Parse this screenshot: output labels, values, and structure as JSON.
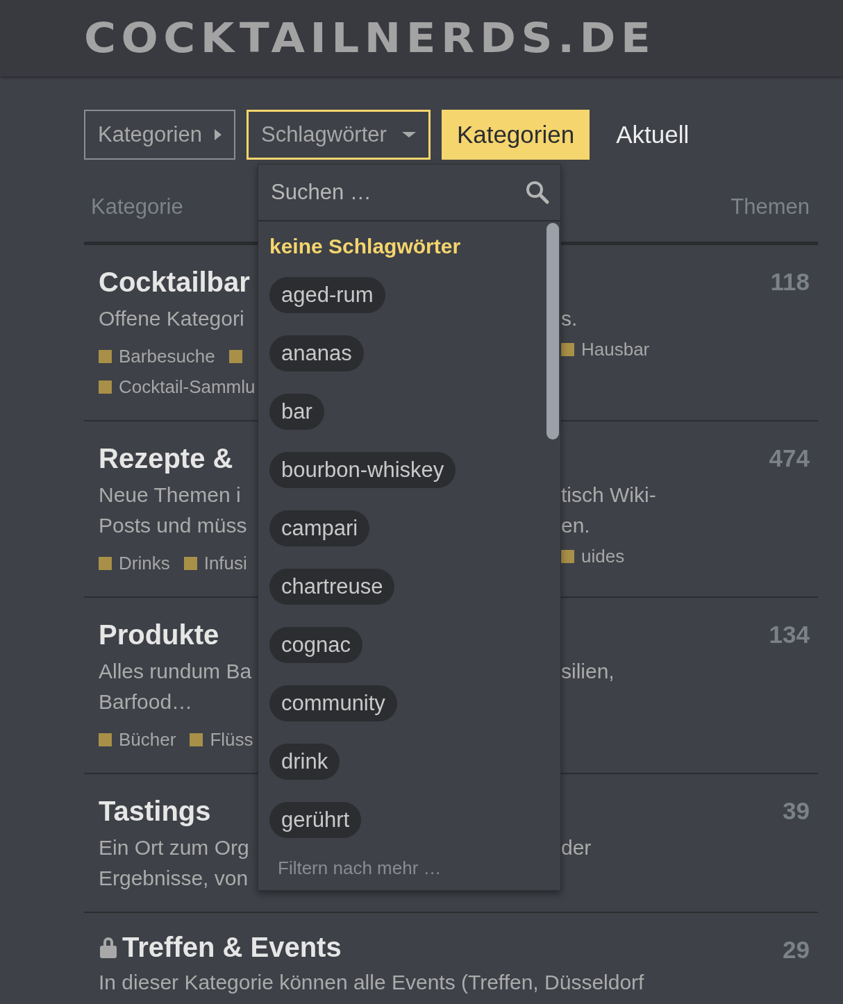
{
  "header": {
    "logo": "COCKTAILNERDS.DE"
  },
  "nav": [
    {
      "kind": "menu",
      "label": "Kategorien"
    },
    {
      "kind": "dropdown",
      "label": "Schlagwörter",
      "expanded": true
    },
    {
      "kind": "tab",
      "label": "Kategorien",
      "selected": true
    },
    {
      "kind": "tab",
      "label": "Aktuell",
      "selected": false
    }
  ],
  "table": {
    "columns": [
      "Kategorie",
      "Themen"
    ],
    "rows": [
      {
        "title": "Cocktailbar",
        "locked": false,
        "count": "118",
        "lines": [
          {
            "left": "Offene Kategori",
            "right": "s."
          }
        ],
        "tag_lines": [
          {
            "left": [
              {
                "kind": "tag",
                "label": "Barbesuche"
              },
              {
                "kind": "cut"
              }
            ],
            "right": [
              {
                "kind": "tag",
                "label": "Hausbar"
              }
            ]
          },
          {
            "left": [
              {
                "kind": "tag",
                "label": "Cocktail-Sammlu"
              }
            ]
          }
        ]
      },
      {
        "title": "Rezepte &",
        "locked": false,
        "count": "474",
        "lines": [
          {
            "left": "Neue Themen i",
            "right": "tisch Wiki-"
          },
          {
            "left": "Posts und müss",
            "right": "en."
          }
        ],
        "tag_lines": [
          {
            "left": [
              {
                "kind": "tag",
                "label": "Drinks"
              },
              {
                "kind": "tag",
                "label": "Infusi"
              }
            ],
            "right": [
              {
                "kind": "tag",
                "label": "uides"
              }
            ]
          }
        ]
      },
      {
        "title": "Produkte",
        "locked": false,
        "count": "134",
        "lines": [
          {
            "left": "Alles rundum Ba",
            "right": "silien,"
          },
          {
            "left": "Barfood…"
          }
        ],
        "tag_lines": [
          {
            "left": [
              {
                "kind": "tag",
                "label": "Bücher"
              },
              {
                "kind": "tag",
                "label": "Flüss"
              }
            ]
          }
        ]
      },
      {
        "title": "Tastings",
        "locked": false,
        "count": "39",
        "lines": [
          {
            "left": "Ein Ort zum Org",
            "right": "der"
          },
          {
            "left": "Ergebnisse, von"
          }
        ]
      },
      {
        "title": "Treffen & Events",
        "locked": true,
        "count": "29",
        "lines": [
          {
            "left": "In dieser Kategorie können alle Events (Treffen, Düsseldorf"
          }
        ]
      }
    ]
  },
  "tag_dropdown": {
    "search": {
      "placeholder": "Suchen …"
    },
    "items": [
      {
        "kind": "none",
        "label": "keine Schlagwörter"
      },
      {
        "kind": "tag",
        "label": "aged-rum"
      },
      {
        "kind": "tag",
        "label": "ananas"
      },
      {
        "kind": "tag",
        "label": "bar"
      },
      {
        "kind": "tag",
        "label": "bourbon-whiskey"
      },
      {
        "kind": "tag",
        "label": "campari"
      },
      {
        "kind": "tag",
        "label": "chartreuse"
      },
      {
        "kind": "tag",
        "label": "cognac"
      },
      {
        "kind": "tag",
        "label": "community"
      },
      {
        "kind": "tag",
        "label": "drink"
      },
      {
        "kind": "tag",
        "label": "gerührt"
      }
    ],
    "footer": "Filtern nach mehr …"
  }
}
